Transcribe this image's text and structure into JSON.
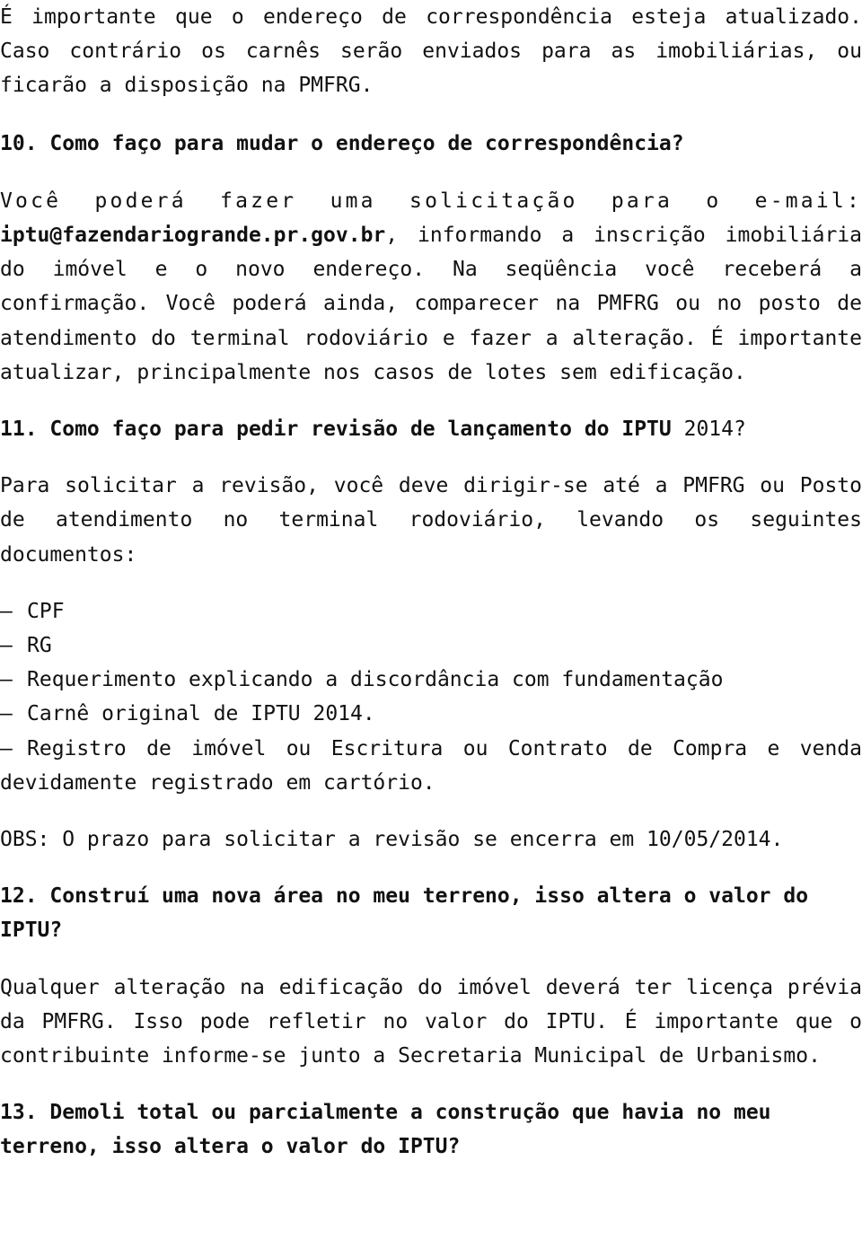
{
  "intro": {
    "text": "É importante que o endereço de correspondência esteja atualizado. Caso contrário os carnês serão enviados para as imobiliárias, ou ficarão a disposição na PMFRG."
  },
  "q10": {
    "question": "10. Como faço para mudar o endereço de correspondência?",
    "answer_lead": "Você poderá fazer uma solicitação para o e-mail:",
    "email": "iptu@fazendariogrande.pr.gov.br",
    "answer_after_email": ", informando a inscrição imobiliária do imóvel e o novo endereço. Na seqüência você receberá a confirmação. Você poderá ainda, comparecer na PMFRG ou no posto de atendimento do terminal rodoviário e fazer a alteração. É importante atualizar, principalmente nos casos de lotes sem edificação."
  },
  "q11": {
    "question_bold": "11. Como faço para pedir revisão de lançamento do IPTU",
    "question_tail": " 2014?",
    "answer": "Para solicitar a revisão, você deve dirigir-se até a PMFRG ou Posto de atendimento no terminal rodoviário, levando os seguintes documentos:",
    "documents": [
      "CPF",
      "RG",
      "Requerimento explicando a discordância com fundamentação",
      "Carnê original de IPTU 2014.",
      "Registro de imóvel ou Escritura ou Contrato de Compra e venda devidamente registrado em cartório."
    ],
    "bullet": "–",
    "obs": "OBS: O prazo para solicitar a revisão se encerra em 10/05/2014."
  },
  "q12": {
    "question": "12. Construí uma nova área no meu terreno, isso altera o valor do IPTU?",
    "answer": "Qualquer alteração na edificação do imóvel deverá ter licença prévia da PMFRG. Isso pode refletir no valor do IPTU. É importante que o contribuinte informe-se junto a Secretaria Municipal de Urbanismo."
  },
  "q13": {
    "question": "13. Demoli total ou parcialmente a construção que havia no meu terreno, isso altera o valor do IPTU?"
  }
}
